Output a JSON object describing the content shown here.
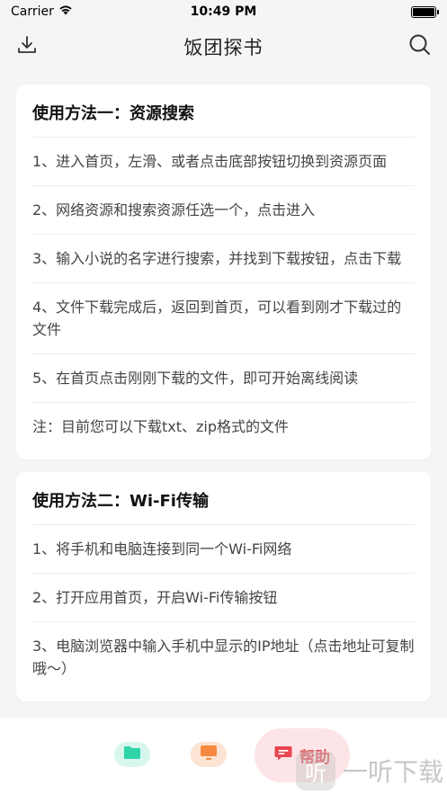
{
  "status_bar": {
    "carrier": "Carrier",
    "time": "10:49 PM"
  },
  "nav": {
    "title": "饭团探书",
    "left_icon": "download-icon",
    "right_icon": "search-icon"
  },
  "cards": [
    {
      "title": "使用方法一：资源搜索",
      "items": [
        "1、进入首页，左滑、或者点击底部按钮切换到资源页面",
        "2、网络资源和搜索资源任选一个，点击进入",
        "3、输入小说的名字进行搜索，并找到下载按钮，点击下载",
        "4、文件下载完成后，返回到首页，可以看到刚才下载过的文件",
        "5、在首页点击刚刚下载的文件，即可开始离线阅读",
        "注：目前您可以下载txt、zip格式的文件"
      ]
    },
    {
      "title": "使用方法二：Wi-Fi传输",
      "items": [
        "1、将手机和电脑连接到同一个Wi-Fi网络",
        "2、打开应用首页，开启Wi-Fi传输按钮",
        "3、电脑浏览器中输入手机中显示的IP地址（点击地址可复制哦～）"
      ]
    }
  ],
  "tab_bar": {
    "files_icon": "folder-icon",
    "tv_icon": "monitor-icon",
    "help_icon": "message-icon",
    "help_label": "帮助",
    "colors": {
      "files": "#2ed3a8",
      "tv": "#f5893f",
      "help": "#e8454f"
    }
  },
  "watermark": {
    "logo_char": "听",
    "text": "一听下载"
  }
}
